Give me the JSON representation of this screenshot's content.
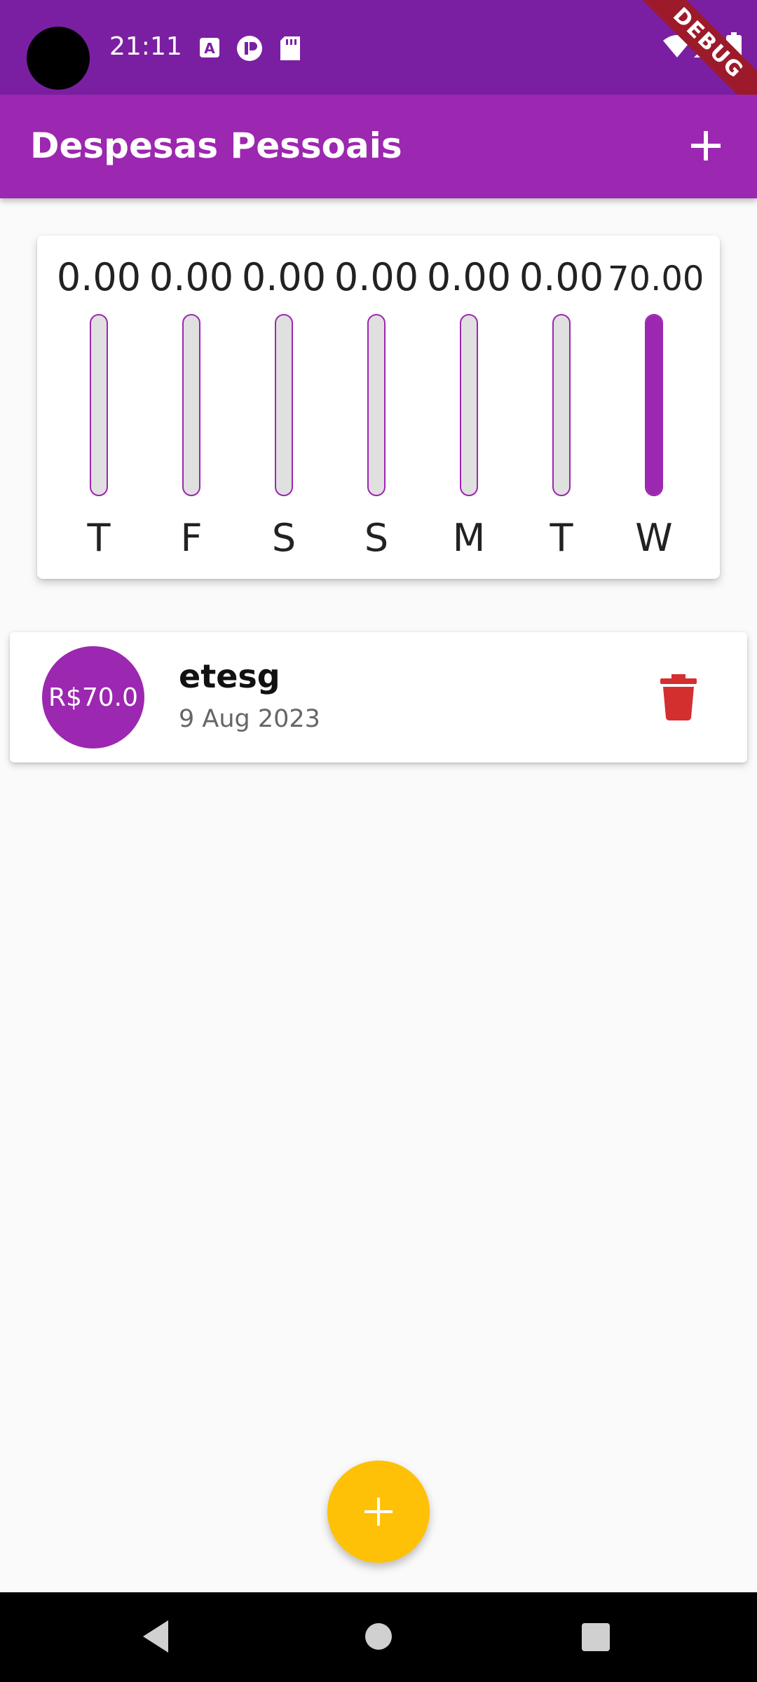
{
  "status_bar": {
    "time": "21:11",
    "icons": [
      "a-icon",
      "p-icon",
      "sd-card-icon",
      "wifi-icon",
      "signal-icon",
      "battery-icon"
    ]
  },
  "debug_banner": "DEBUG",
  "app_bar": {
    "title": "Despesas Pessoais",
    "add_icon": "plus-icon"
  },
  "chart": {
    "columns": [
      {
        "day": "T",
        "value": "0.00",
        "fill": 0
      },
      {
        "day": "F",
        "value": "0.00",
        "fill": 0
      },
      {
        "day": "S",
        "value": "0.00",
        "fill": 0
      },
      {
        "day": "S",
        "value": "0.00",
        "fill": 0
      },
      {
        "day": "M",
        "value": "0.00",
        "fill": 0
      },
      {
        "day": "T",
        "value": "0.00",
        "fill": 0
      },
      {
        "day": "W",
        "value": "70.00",
        "fill": 1
      }
    ]
  },
  "transactions": [
    {
      "amount": "R$70.0",
      "title": "etesg",
      "date": "9 Aug 2023",
      "delete_icon": "trash-icon"
    }
  ],
  "fab": {
    "icon": "plus-icon"
  },
  "nav": {
    "back": "back-icon",
    "home": "home-icon",
    "recents": "recents-icon"
  },
  "colors": {
    "primary": "#9c27b0",
    "primary_dark": "#7b1fa2",
    "accent": "#ffc107",
    "delete": "#d32f2f"
  }
}
